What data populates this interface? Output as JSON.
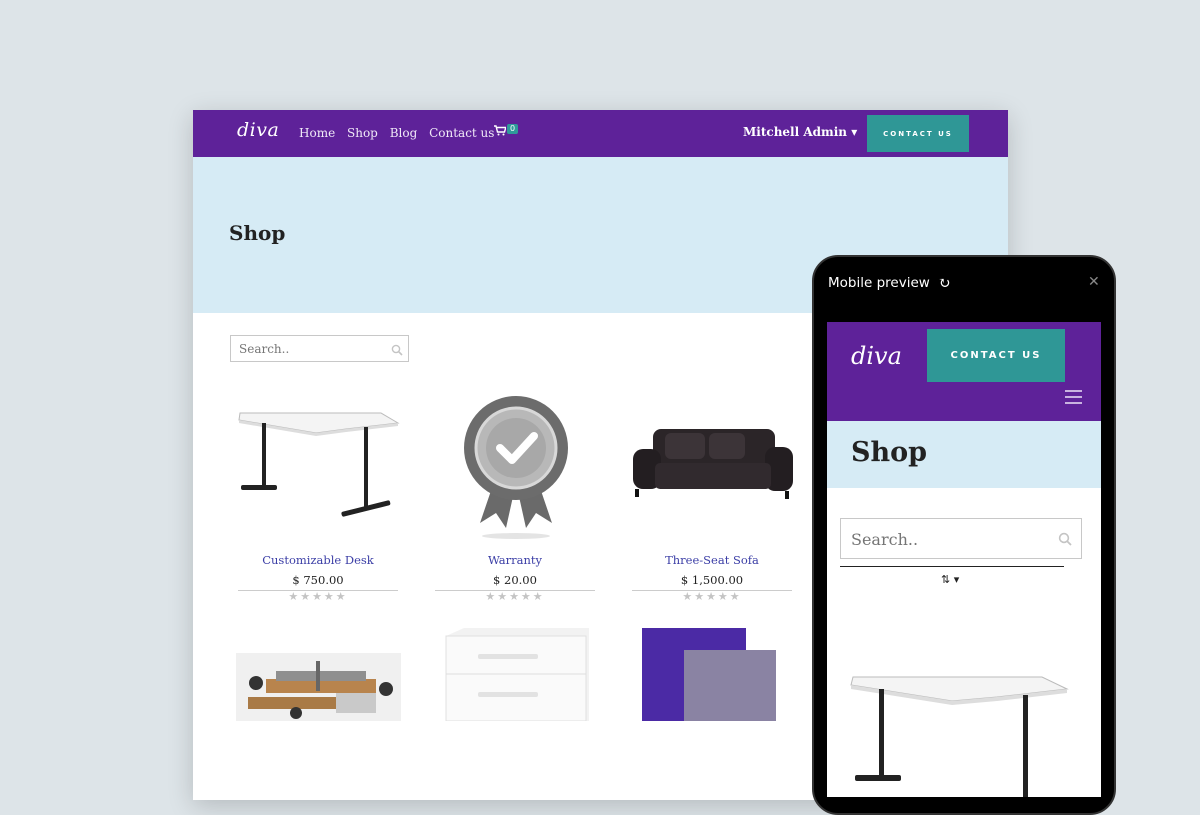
{
  "site": {
    "logo": "diva",
    "menu": [
      "Home",
      "Shop",
      "Blog",
      "Contact us"
    ],
    "cart_count": "0",
    "user": "Mitchell Admin ▾",
    "contact_button": "CONTACT US"
  },
  "hero": {
    "title": "Shop"
  },
  "search": {
    "placeholder": "Search.."
  },
  "products": [
    {
      "name": "Customizable Desk",
      "price": "$ 750.00",
      "stars": "★★★★★"
    },
    {
      "name": "Warranty",
      "price": "$ 20.00",
      "stars": "★★★★★"
    },
    {
      "name": "Three-Seat Sofa",
      "price": "$ 1,500.00",
      "stars": "★★★★★"
    }
  ],
  "preview": {
    "title": "Mobile preview",
    "refresh_icon": "↻",
    "close_icon": "✕",
    "logo": "diva",
    "contact_button": "CONTACT US",
    "shop_title": "Shop",
    "search_placeholder": "Search..",
    "sort_icon": "⇅ ▾"
  },
  "colors": {
    "brand_purple": "#5e2299",
    "accent_teal": "#2f9796",
    "hero_bg": "#d6ebf5"
  }
}
